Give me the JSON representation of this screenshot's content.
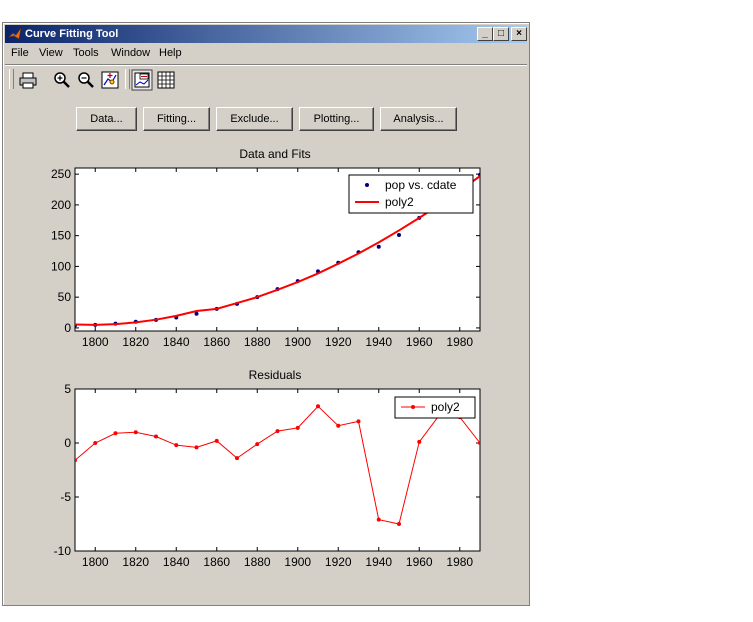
{
  "window": {
    "title": "Curve Fitting Tool",
    "minimize_glyph": "_",
    "maximize_glyph": "□",
    "close_glyph": "×"
  },
  "menubar": {
    "items": [
      "File",
      "View",
      "Tools",
      "Window",
      "Help"
    ]
  },
  "toolbar": {
    "icons": [
      "print-icon",
      "zoom-in-icon",
      "zoom-out-icon",
      "data-cursor-icon",
      "legend-toggle-icon",
      "grid-toggle-icon"
    ]
  },
  "buttons": [
    "Data...",
    "Fitting...",
    "Exclude...",
    "Plotting...",
    "Analysis..."
  ],
  "chart_data": [
    {
      "type": "scatter",
      "title": "Data and Fits",
      "xlim": [
        1790,
        1990
      ],
      "ylim": [
        -5,
        260
      ],
      "xticks": [
        1800,
        1820,
        1840,
        1860,
        1880,
        1900,
        1920,
        1940,
        1960,
        1980
      ],
      "yticks": [
        0,
        50,
        100,
        150,
        200,
        250
      ],
      "legend_placement": "top-right",
      "series": [
        {
          "name": "pop vs. cdate",
          "kind": "points",
          "color": "#00007f",
          "x": [
            1790,
            1800,
            1810,
            1820,
            1830,
            1840,
            1850,
            1860,
            1870,
            1880,
            1890,
            1900,
            1910,
            1920,
            1930,
            1940,
            1950,
            1960,
            1970,
            1980,
            1990
          ],
          "y": [
            4,
            5,
            7,
            10,
            13,
            17,
            23,
            31,
            39,
            50,
            63,
            76,
            92,
            106,
            123,
            132,
            151,
            179,
            203,
            226,
            249
          ]
        },
        {
          "name": "poly2",
          "kind": "line",
          "color": "#ff0000",
          "x": [
            1790,
            1800,
            1810,
            1820,
            1830,
            1840,
            1850,
            1860,
            1870,
            1880,
            1890,
            1900,
            1910,
            1920,
            1930,
            1940,
            1950,
            1960,
            1970,
            1980,
            1990
          ],
          "y": [
            5.6,
            5.0,
            6.1,
            9.0,
            13.4,
            19.6,
            27.5,
            31.0,
            40.4,
            50.1,
            61.9,
            74.6,
            88.6,
            104.4,
            121.0,
            139.1,
            158.5,
            178.9,
            200.4,
            223.0,
            246.8
          ]
        }
      ]
    },
    {
      "type": "line",
      "title": "Residuals",
      "xlim": [
        1790,
        1990
      ],
      "ylim": [
        -10,
        5
      ],
      "xticks": [
        1800,
        1820,
        1840,
        1860,
        1880,
        1900,
        1920,
        1940,
        1960,
        1980
      ],
      "yticks": [
        -10,
        -5,
        0,
        5
      ],
      "legend_placement": "top-right",
      "series": [
        {
          "name": "poly2",
          "color": "#ff0000",
          "x": [
            1790,
            1800,
            1810,
            1820,
            1830,
            1840,
            1850,
            1860,
            1870,
            1880,
            1890,
            1900,
            1910,
            1920,
            1930,
            1940,
            1950,
            1960,
            1970,
            1980,
            1990
          ],
          "y": [
            -1.6,
            0.0,
            0.9,
            1.0,
            0.6,
            -0.2,
            -0.4,
            0.2,
            -1.4,
            -0.1,
            1.1,
            1.4,
            3.4,
            1.6,
            2.0,
            -7.1,
            -7.5,
            0.1,
            2.6,
            2.4,
            0.0
          ]
        }
      ]
    }
  ]
}
